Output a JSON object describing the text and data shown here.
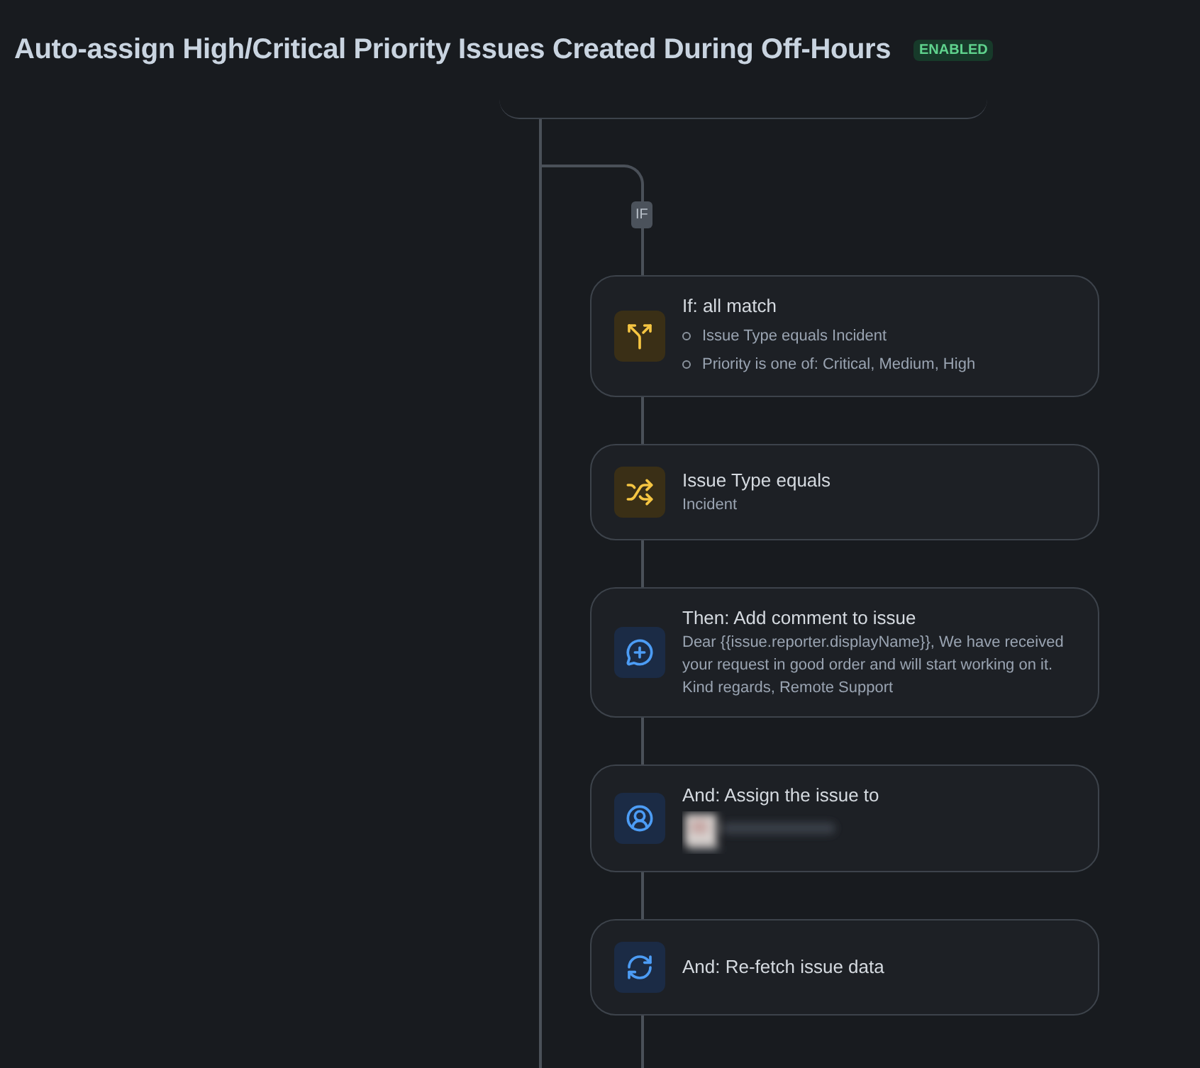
{
  "title": "Auto-assign High/Critical Priority Issues Created During Off-Hours",
  "status": {
    "label": "ENABLED",
    "enabled": true
  },
  "branch_label": "IF",
  "steps": [
    {
      "kind": "condition",
      "title": "If: all match",
      "bullets": [
        "Issue Type equals Incident",
        "Priority is one of: Critical, Medium, High"
      ]
    },
    {
      "kind": "condition",
      "title": "Issue Type equals",
      "detail": "Incident"
    },
    {
      "kind": "action",
      "title": "Then: Add comment to issue",
      "detail": "Dear {{issue.reporter.displayName}}, We have received your request in good order and will start working on it. Kind regards, Remote Support"
    },
    {
      "kind": "action",
      "title": "And: Assign the issue to"
    },
    {
      "kind": "action",
      "title": "And: Re-fetch issue data"
    }
  ]
}
